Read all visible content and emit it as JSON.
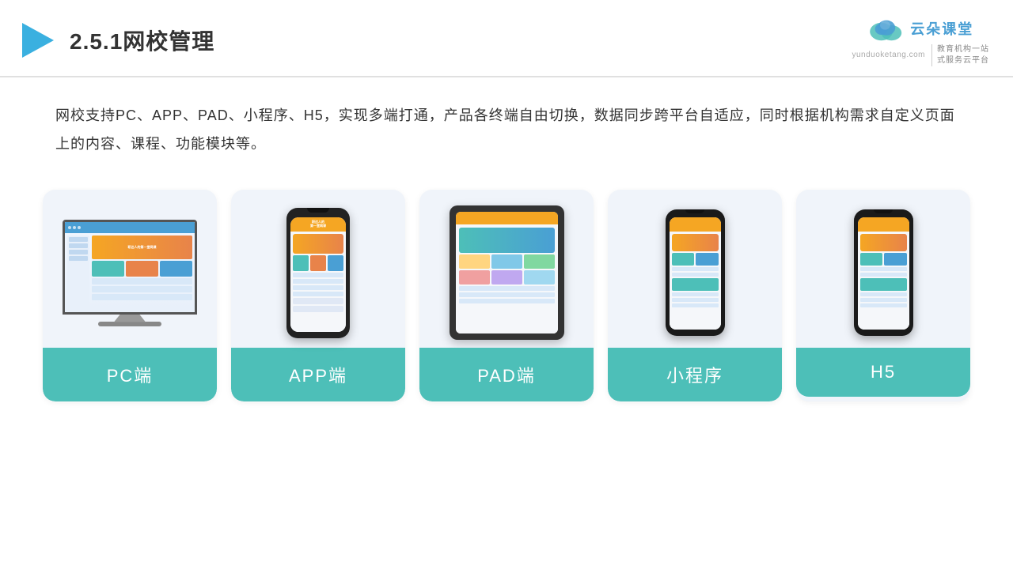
{
  "header": {
    "title": "2.5.1网校管理",
    "logo_text": "云朵课堂",
    "logo_url": "yunduoketang.com",
    "logo_tagline": "教育机构一站\n式服务云平台"
  },
  "description": {
    "text": "网校支持PC、APP、PAD、小程序、H5，实现多端打通，产品各终端自由切换，数据同步跨平台自适应，同时根据机构需求自定义页面上的内容、课程、功能模块等。"
  },
  "cards": [
    {
      "id": "pc",
      "label": "PC端"
    },
    {
      "id": "app",
      "label": "APP端"
    },
    {
      "id": "pad",
      "label": "PAD端"
    },
    {
      "id": "miniapp",
      "label": "小程序"
    },
    {
      "id": "h5",
      "label": "H5"
    }
  ],
  "colors": {
    "teal": "#4dbfb8",
    "accent": "#f5a623",
    "blue": "#4a9fd4",
    "dark": "#333"
  }
}
